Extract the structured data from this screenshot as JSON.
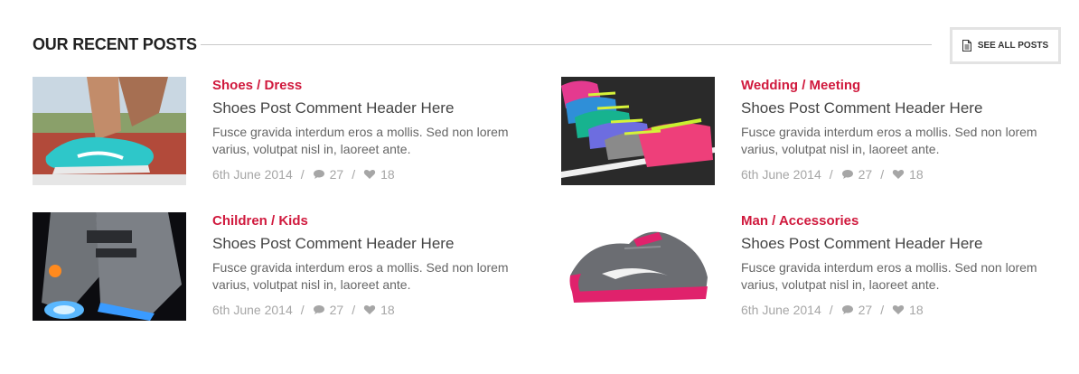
{
  "section": {
    "title": "OUR RECENT POSTS",
    "see_all_label": "SEE ALL POSTS"
  },
  "posts": [
    {
      "category": "Shoes / Dress",
      "headline": "Shoes Post Comment Header Here",
      "excerpt": "Fusce gravida interdum eros a mollis. Sed non lorem varius, volutpat nisl in, laoreet ante.",
      "date": "6th June 2014",
      "comments": "27",
      "likes": "18",
      "image": "turquoise-running-shoe-photo"
    },
    {
      "category": "Wedding / Meeting",
      "headline": "Shoes Post Comment Header Here",
      "excerpt": "Fusce gravida interdum eros a mollis. Sed non lorem varius, volutpat nisl in, laoreet ante.",
      "date": "6th June 2014",
      "comments": "27",
      "likes": "18",
      "image": "row-of-colorful-sneakers-photo"
    },
    {
      "category": "Children / Kids",
      "headline": "Shoes Post Comment Header Here",
      "excerpt": "Fusce gravida interdum eros a mollis. Sed non lorem varius, volutpat nisl in, laoreet ante.",
      "date": "6th June 2014",
      "comments": "27",
      "likes": "18",
      "image": "light-up-grey-sneakers-photo"
    },
    {
      "category": "Man / Accessories",
      "headline": "Shoes Post Comment Header Here",
      "excerpt": "Fusce gravida interdum eros a mollis. Sed non lorem varius, volutpat nisl in, laoreet ante.",
      "date": "6th June 2014",
      "comments": "27",
      "likes": "18",
      "image": "pink-grey-running-shoe-photo"
    }
  ],
  "colors": {
    "category": "#d0193d",
    "meta": "#a6a6a6",
    "title": "#222222"
  }
}
